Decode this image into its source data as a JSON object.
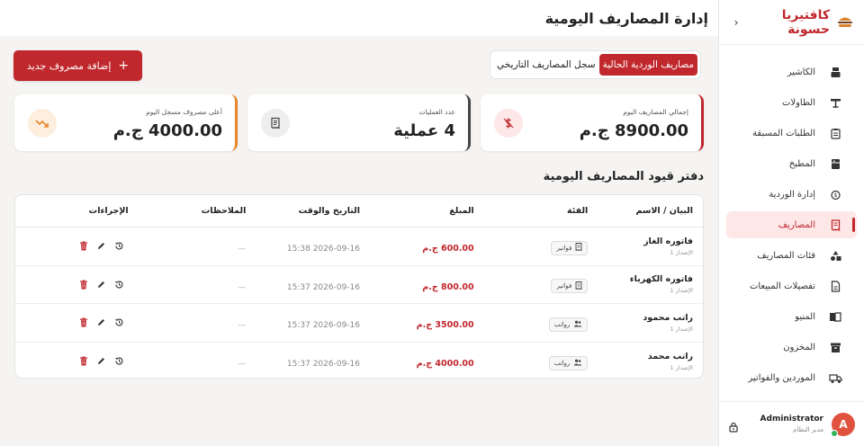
{
  "brand": {
    "name": "كافتيريا حسونة",
    "toggle": "‹"
  },
  "nav": [
    {
      "key": "cashier",
      "label": "الكاشير",
      "icon": "cash-register-icon",
      "active": false
    },
    {
      "key": "tables",
      "label": "الطاولات",
      "icon": "table-icon",
      "active": false
    },
    {
      "key": "preorders",
      "label": "الطلبات المسبقة",
      "icon": "clipboard-icon",
      "active": false
    },
    {
      "key": "kitchen",
      "label": "المطبخ",
      "icon": "kitchen-icon",
      "active": false
    },
    {
      "key": "shift",
      "label": "إدارة الوردية",
      "icon": "shift-icon",
      "active": false
    },
    {
      "key": "expenses",
      "label": "المصاريف",
      "icon": "receipt-icon",
      "active": true
    },
    {
      "key": "expense-categories",
      "label": "فئات المصاريف",
      "icon": "categories-icon",
      "active": false
    },
    {
      "key": "sales-details",
      "label": "تفصيلات المبيعات",
      "icon": "document-icon",
      "active": false
    },
    {
      "key": "menu",
      "label": "المنيو",
      "icon": "book-icon",
      "active": false
    },
    {
      "key": "inventory",
      "label": "المخزون",
      "icon": "archive-icon",
      "active": false
    },
    {
      "key": "suppliers",
      "label": "الموردين والفواتير",
      "icon": "truck-icon",
      "active": false
    }
  ],
  "user": {
    "name": "Administrator",
    "role": "مدير النظام",
    "initial": "A"
  },
  "page": {
    "title": "إدارة المصاريف اليومية"
  },
  "tabs": [
    {
      "label": "مصاريف الوردية الحالية",
      "active": true
    },
    {
      "label": "سجل المصاريف التاريخي",
      "active": false
    }
  ],
  "add_button": {
    "label": "إضافة مصروف جديد",
    "icon": "+"
  },
  "cards": [
    {
      "label": "إجمالي المصاريف اليوم",
      "value": "8900.00 ج.م",
      "icon": "dollar-icon",
      "accent": "#c0282d"
    },
    {
      "label": "عدد العمليات",
      "value": "4 عملية",
      "icon": "receipt-icon",
      "accent": "#444444"
    },
    {
      "label": "أعلى مصروف مسجل اليوم",
      "value": "4000.00 ج.م",
      "icon": "trend-icon",
      "accent": "#e8872a"
    }
  ],
  "section": {
    "title": "دفتر قيود المصاريف اليومية"
  },
  "table": {
    "headers": {
      "name": "البيان / الاسم",
      "category": "الفئة",
      "amount": "المبلغ",
      "datetime": "التاريخ والوقت",
      "notes": "الملاحظات",
      "actions": "الإجراءات"
    },
    "rows": [
      {
        "name": "فاتوره الغاز",
        "version": "الإصدار 1",
        "category": "فواتير",
        "category_icon": "bill",
        "amount": "600.00 ج.م",
        "datetime": "2026-09-16 15:38",
        "notes": "—"
      },
      {
        "name": "فاتوره الكهرباء",
        "version": "الإصدار 1",
        "category": "فواتير",
        "category_icon": "bill",
        "amount": "800.00 ج.م",
        "datetime": "2026-09-16 15:37",
        "notes": "—"
      },
      {
        "name": "راتب محمود",
        "version": "الإصدار 1",
        "category": "رواتب",
        "category_icon": "people",
        "amount": "3500.00 ج.م",
        "datetime": "2026-09-16 15:37",
        "notes": "—"
      },
      {
        "name": "راتب محمد",
        "version": "الإصدار 1",
        "category": "رواتب",
        "category_icon": "people",
        "amount": "4000.00 ج.م",
        "datetime": "2026-09-16 15:37",
        "notes": "—"
      }
    ]
  },
  "colors": {
    "primary": "#c0282d",
    "active_bg": "#fde7e7",
    "online": "#2fb35a",
    "avatar": "#e0523d"
  }
}
